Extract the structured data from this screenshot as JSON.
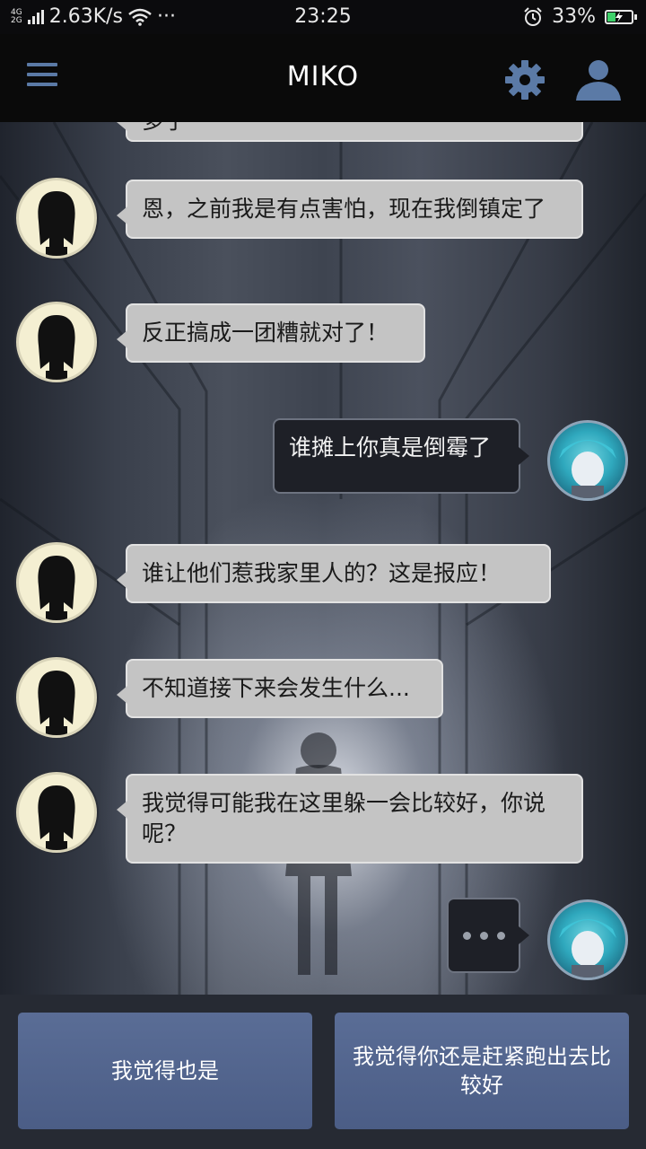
{
  "status_bar": {
    "net_top": "4G",
    "net_bottom": "2G",
    "speed": "2.63K/s",
    "more": "···",
    "time": "23:25",
    "battery": "33%",
    "battery_level": 0.33,
    "alarm_icon": "alarm-clock-icon",
    "wifi_icon": "wifi-icon"
  },
  "app_bar": {
    "title": "MIKO",
    "menu_icon": "hamburger-menu-icon",
    "settings_icon": "gear-icon",
    "profile_icon": "user-icon",
    "icon_color": "#5b7aa6"
  },
  "messages": [
    {
      "from": "npc",
      "text": "多了"
    },
    {
      "from": "npc",
      "text": "恩，之前我是有点害怕，现在我倒镇定了"
    },
    {
      "from": "npc",
      "text": "反正搞成一团糟就对了！"
    },
    {
      "from": "me",
      "text": "谁摊上你真是倒霉了"
    },
    {
      "from": "npc",
      "text": "谁让他们惹我家里人的？这是报应！"
    },
    {
      "from": "npc",
      "text": "不知道接下来会发生什么..."
    },
    {
      "from": "npc",
      "text": "我觉得可能我在这里躲一会比较好，你说呢？"
    },
    {
      "from": "me",
      "typing": true
    }
  ],
  "replies": [
    {
      "label": "我觉得也是"
    },
    {
      "label": "我觉得你还是赶紧跑出去比较好"
    }
  ],
  "colors": {
    "npc_bubble": "#c4c4c4",
    "me_bubble": "#1e2027",
    "reply_button": "#52648d"
  }
}
